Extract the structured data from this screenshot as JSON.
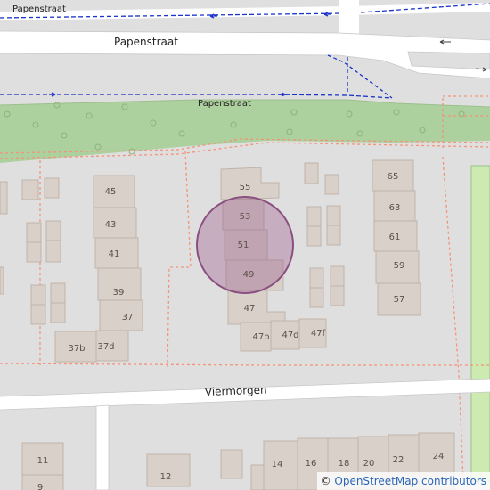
{
  "map": {
    "streets": {
      "top": "Papenstraat",
      "main": "Papenstraat",
      "path": "Papenstraat",
      "bottom": "Viermorgen"
    },
    "house_numbers": {
      "h45": "45",
      "h43": "43",
      "h41": "41",
      "h39": "39",
      "h37": "37",
      "h37b": "37b",
      "h37d": "37d",
      "h55": "55",
      "h53": "53",
      "h51": "51",
      "h49": "49",
      "h47": "47",
      "h47b": "47b",
      "h47d": "47d",
      "h47f": "47f",
      "h65": "65",
      "h63": "63",
      "h61": "61",
      "h59": "59",
      "h57": "57",
      "h11": "11",
      "h9": "9",
      "h12": "12",
      "h14": "14",
      "h16": "16",
      "h18": "18",
      "h20": "20",
      "h22": "22",
      "h24": "24"
    },
    "marker_color": "#9b5c8f",
    "park_color": "#add19e",
    "building_color": "#d9d0c9",
    "road_color": "#ffffff"
  },
  "attribution": {
    "symbol": "©",
    "text": "OpenStreetMap contributors"
  }
}
